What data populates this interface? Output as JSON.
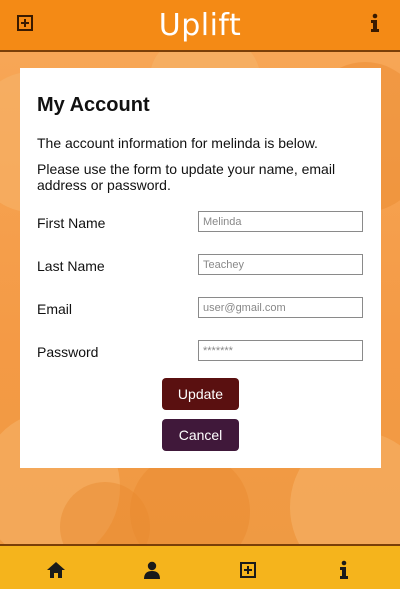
{
  "app": {
    "name": "Uplift"
  },
  "topbar": {
    "add_icon": "plus-square-icon",
    "info_icon": "info-icon"
  },
  "account": {
    "title": "My Account",
    "intro": "The account information for melinda is below.",
    "instructions": "Please use the form to update your name, email address or password.",
    "fields": [
      {
        "label": "First Name",
        "value": "Melinda"
      },
      {
        "label": "Last Name",
        "value": "Teachey"
      },
      {
        "label": "Email",
        "value": "user@gmail.com"
      },
      {
        "label": "Password",
        "value": "*******"
      }
    ],
    "update_label": "Update",
    "cancel_label": "Cancel"
  },
  "bottom_nav": [
    {
      "icon": "home-icon"
    },
    {
      "icon": "user-icon"
    },
    {
      "icon": "plus-square-icon"
    },
    {
      "icon": "info-icon"
    }
  ],
  "colors": {
    "topbar": "#f48a15",
    "bottombar": "#f5b41c",
    "update": "#5a1010",
    "cancel": "#40183a"
  }
}
